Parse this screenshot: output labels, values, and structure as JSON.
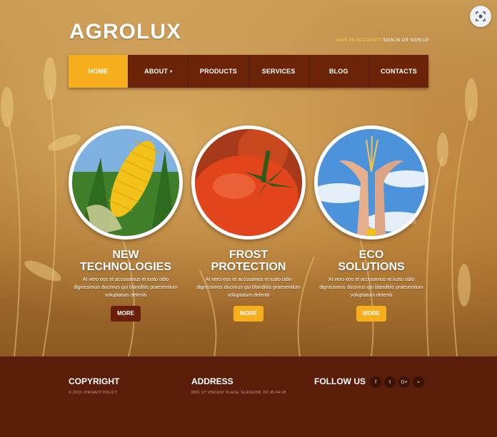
{
  "brand": {
    "logo": "AGROLUX"
  },
  "account": {
    "question": "HAVE AN ACCOUNT?",
    "links": "SIGN IN OR SIGN UP"
  },
  "nav": [
    {
      "label": "HOME",
      "active": true
    },
    {
      "label": "ABOUT",
      "caret": "▾"
    },
    {
      "label": "PRODUCTS"
    },
    {
      "label": "SERVICES"
    },
    {
      "label": "BLOG"
    },
    {
      "label": "CONTACTS"
    }
  ],
  "features": [
    {
      "title_1": "NEW",
      "title_2": "TECHNOLOGIES",
      "text": "At vero eos et accusamus et iusto odio dignissimos ducimus qui blanditiis praesentium voluptatum deleniti",
      "button": "MORE",
      "image": "corn-cob"
    },
    {
      "title_1": "FROST",
      "title_2": "PROTECTION",
      "text": "At vero eos et accusamus et iusto odio dignissimos ducimus qui blanditiis praesentium voluptatum deleniti",
      "button": "MORE",
      "image": "tomato"
    },
    {
      "title_1": "ECO",
      "title_2": "SOLUTIONS",
      "text": "At vero eos et accusamus et iusto odio dignissimos ducimus qui blanditiis praesentium voluptatum deleniti",
      "button": "MORE",
      "image": "hands-with-wheat"
    }
  ],
  "footer": {
    "copyright": {
      "title": "COPYRIGHT",
      "text": "© 2013 | PRIVACY POLICY"
    },
    "address": {
      "title": "ADDRESS",
      "text": "8901 ST VINCENT PLACE, GLASGOW, DC 45 FR 45"
    },
    "follow": {
      "title": "FOLLOW US"
    },
    "social": [
      {
        "icon": "facebook-icon",
        "glyph": "f"
      },
      {
        "icon": "twitter-icon",
        "glyph": "t"
      },
      {
        "icon": "google-plus-icon",
        "glyph": "G+"
      },
      {
        "icon": "rss-icon",
        "glyph": "⌁"
      }
    ]
  },
  "colors": {
    "accent": "#f7ae1c",
    "nav": "#6b2408",
    "footer": "#5a1d0a"
  }
}
